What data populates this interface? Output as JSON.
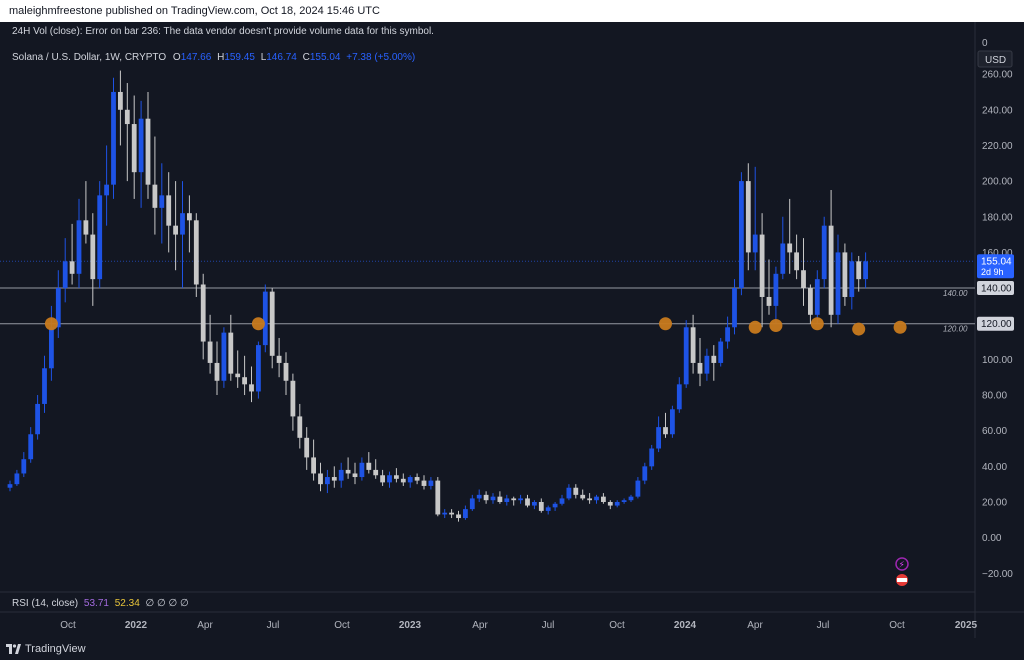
{
  "header": {
    "published_by": "maleighmfreestone published on TradingView.com, Oct 18, 2024 15:46 UTC"
  },
  "status_line": {
    "vol_error": "24H Vol (close): Error on bar 236: The data vendor doesn't provide volume data for this symbol."
  },
  "symbol_line": {
    "name": "Solana / U.S. Dollar, 1W, CRYPTO",
    "o_label": "O",
    "o_value": "147.66",
    "h_label": "H",
    "h_value": "159.45",
    "l_label": "L",
    "l_value": "146.74",
    "c_label": "C",
    "c_value": "155.04",
    "change": "+7.38 (+5.00%)"
  },
  "currency": "USD",
  "price_axis_top": "0",
  "last_price": {
    "value": "155.04",
    "countdown": "2d 9h"
  },
  "rsi": {
    "label": "RSI (14, close)",
    "value1": "53.71",
    "value2": "52.34",
    "extras": "∅ ∅ ∅ ∅"
  },
  "footer": {
    "brand": "TradingView"
  },
  "colors": {
    "background": "#131722",
    "up": "#1e53e5",
    "down": "#c8c8c8",
    "marker": "#c87a1e",
    "grid": "#1e222d",
    "text": "#d1d4dc"
  },
  "chart_data": {
    "type": "candlestick",
    "timeframe": "1W",
    "y_ticks": [
      "260.00",
      "240.00",
      "220.00",
      "200.00",
      "180.00",
      "160.00",
      "140.00",
      "120.00",
      "100.00",
      "80.00",
      "60.00",
      "40.00",
      "20.00",
      "0.00",
      "−20.00"
    ],
    "y_range": [
      -26,
      264
    ],
    "x_ticks": [
      "Oct",
      "2022",
      "Apr",
      "Jul",
      "Oct",
      "2023",
      "Apr",
      "Jul",
      "Oct",
      "2024",
      "Apr",
      "Jul",
      "Oct",
      "2025"
    ],
    "horizontal_lines": [
      {
        "value": 140,
        "label": "140.00"
      },
      {
        "value": 120,
        "label": "120.00"
      }
    ],
    "axis_badges": [
      {
        "value": 140,
        "text": "140.00"
      },
      {
        "value": 120,
        "text": "120.00"
      }
    ],
    "ohlc": [
      [
        28,
        32,
        26,
        30
      ],
      [
        30,
        38,
        29,
        36
      ],
      [
        36,
        48,
        34,
        44
      ],
      [
        44,
        62,
        42,
        58
      ],
      [
        58,
        80,
        55,
        75
      ],
      [
        75,
        102,
        70,
        95
      ],
      [
        95,
        130,
        88,
        118
      ],
      [
        118,
        150,
        112,
        140
      ],
      [
        140,
        168,
        132,
        155
      ],
      [
        155,
        176,
        142,
        148
      ],
      [
        148,
        190,
        140,
        178
      ],
      [
        178,
        200,
        165,
        170
      ],
      [
        170,
        182,
        130,
        145
      ],
      [
        145,
        200,
        140,
        192
      ],
      [
        192,
        220,
        175,
        198
      ],
      [
        198,
        258,
        190,
        250
      ],
      [
        250,
        262,
        220,
        240
      ],
      [
        240,
        255,
        200,
        232
      ],
      [
        232,
        248,
        190,
        205
      ],
      [
        205,
        245,
        185,
        235
      ],
      [
        235,
        250,
        190,
        198
      ],
      [
        198,
        225,
        170,
        185
      ],
      [
        185,
        210,
        165,
        192
      ],
      [
        192,
        205,
        160,
        175
      ],
      [
        175,
        200,
        150,
        170
      ],
      [
        170,
        200,
        140,
        182
      ],
      [
        182,
        192,
        160,
        178
      ],
      [
        178,
        182,
        135,
        142
      ],
      [
        142,
        148,
        100,
        110
      ],
      [
        110,
        125,
        92,
        98
      ],
      [
        98,
        110,
        80,
        88
      ],
      [
        88,
        118,
        84,
        115
      ],
      [
        115,
        125,
        88,
        92
      ],
      [
        92,
        105,
        84,
        90
      ],
      [
        90,
        102,
        80,
        86
      ],
      [
        86,
        96,
        76,
        82
      ],
      [
        82,
        110,
        78,
        108
      ],
      [
        108,
        142,
        104,
        138
      ],
      [
        138,
        140,
        95,
        102
      ],
      [
        102,
        112,
        90,
        98
      ],
      [
        98,
        104,
        80,
        88
      ],
      [
        88,
        92,
        60,
        68
      ],
      [
        68,
        75,
        50,
        56
      ],
      [
        56,
        62,
        38,
        45
      ],
      [
        45,
        55,
        32,
        36
      ],
      [
        36,
        42,
        26,
        30
      ],
      [
        30,
        38,
        25,
        34
      ],
      [
        34,
        40,
        28,
        32
      ],
      [
        32,
        42,
        28,
        38
      ],
      [
        38,
        45,
        33,
        36
      ],
      [
        36,
        42,
        30,
        34
      ],
      [
        34,
        45,
        32,
        42
      ],
      [
        42,
        48,
        36,
        38
      ],
      [
        38,
        44,
        33,
        35
      ],
      [
        35,
        38,
        29,
        31
      ],
      [
        31,
        37,
        28,
        35
      ],
      [
        35,
        39,
        31,
        33
      ],
      [
        33,
        36,
        29,
        31
      ],
      [
        31,
        35,
        28,
        34
      ],
      [
        34,
        36,
        30,
        32
      ],
      [
        32,
        35,
        27,
        29
      ],
      [
        29,
        34,
        27,
        32
      ],
      [
        32,
        34,
        12,
        13
      ],
      [
        13,
        16,
        11,
        14
      ],
      [
        14,
        16,
        11,
        13
      ],
      [
        13,
        15,
        9,
        11
      ],
      [
        11,
        18,
        10,
        16
      ],
      [
        16,
        24,
        15,
        22
      ],
      [
        22,
        27,
        20,
        24
      ],
      [
        24,
        26,
        19,
        21
      ],
      [
        21,
        25,
        19,
        23
      ],
      [
        23,
        26,
        19,
        20
      ],
      [
        20,
        24,
        18,
        22
      ],
      [
        22,
        23,
        18,
        21
      ],
      [
        21,
        24,
        19,
        22
      ],
      [
        22,
        24,
        17,
        18
      ],
      [
        18,
        21,
        16,
        20
      ],
      [
        20,
        22,
        14,
        15
      ],
      [
        15,
        18,
        13,
        17
      ],
      [
        17,
        20,
        15,
        19
      ],
      [
        19,
        24,
        18,
        22
      ],
      [
        22,
        30,
        21,
        28
      ],
      [
        28,
        30,
        22,
        24
      ],
      [
        24,
        27,
        21,
        22
      ],
      [
        22,
        25,
        19,
        21
      ],
      [
        21,
        24,
        19,
        23
      ],
      [
        23,
        25,
        19,
        20
      ],
      [
        20,
        21,
        16,
        18
      ],
      [
        18,
        21,
        17,
        20
      ],
      [
        20,
        22,
        19,
        21
      ],
      [
        21,
        24,
        20,
        23
      ],
      [
        23,
        34,
        22,
        32
      ],
      [
        32,
        42,
        30,
        40
      ],
      [
        40,
        52,
        38,
        50
      ],
      [
        50,
        68,
        48,
        62
      ],
      [
        62,
        70,
        56,
        58
      ],
      [
        58,
        74,
        56,
        72
      ],
      [
        72,
        90,
        70,
        86
      ],
      [
        86,
        122,
        84,
        118
      ],
      [
        118,
        125,
        92,
        98
      ],
      [
        98,
        112,
        85,
        92
      ],
      [
        92,
        106,
        88,
        102
      ],
      [
        102,
        108,
        88,
        98
      ],
      [
        98,
        112,
        96,
        110
      ],
      [
        110,
        124,
        106,
        118
      ],
      [
        118,
        145,
        114,
        140
      ],
      [
        140,
        205,
        136,
        200
      ],
      [
        200,
        210,
        150,
        160
      ],
      [
        160,
        208,
        150,
        170
      ],
      [
        170,
        182,
        118,
        135
      ],
      [
        135,
        156,
        125,
        130
      ],
      [
        130,
        152,
        120,
        148
      ],
      [
        148,
        180,
        145,
        165
      ],
      [
        165,
        190,
        148,
        160
      ],
      [
        160,
        170,
        145,
        150
      ],
      [
        150,
        168,
        130,
        140
      ],
      [
        140,
        142,
        120,
        125
      ],
      [
        125,
        150,
        120,
        145
      ],
      [
        145,
        180,
        140,
        175
      ],
      [
        175,
        195,
        118,
        125
      ],
      [
        125,
        170,
        120,
        160
      ],
      [
        160,
        165,
        130,
        135
      ],
      [
        135,
        160,
        128,
        155
      ],
      [
        155,
        158,
        138,
        145
      ],
      [
        145,
        160,
        140,
        155
      ]
    ],
    "circle_markers": [
      {
        "bar": 6,
        "value": 120
      },
      {
        "bar": 36,
        "value": 120
      },
      {
        "bar": 95,
        "value": 120
      },
      {
        "bar": 108,
        "value": 118
      },
      {
        "bar": 111,
        "value": 119
      },
      {
        "bar": 117,
        "value": 120
      },
      {
        "bar": 123,
        "value": 117
      },
      {
        "bar": 129,
        "value": 118
      }
    ]
  }
}
